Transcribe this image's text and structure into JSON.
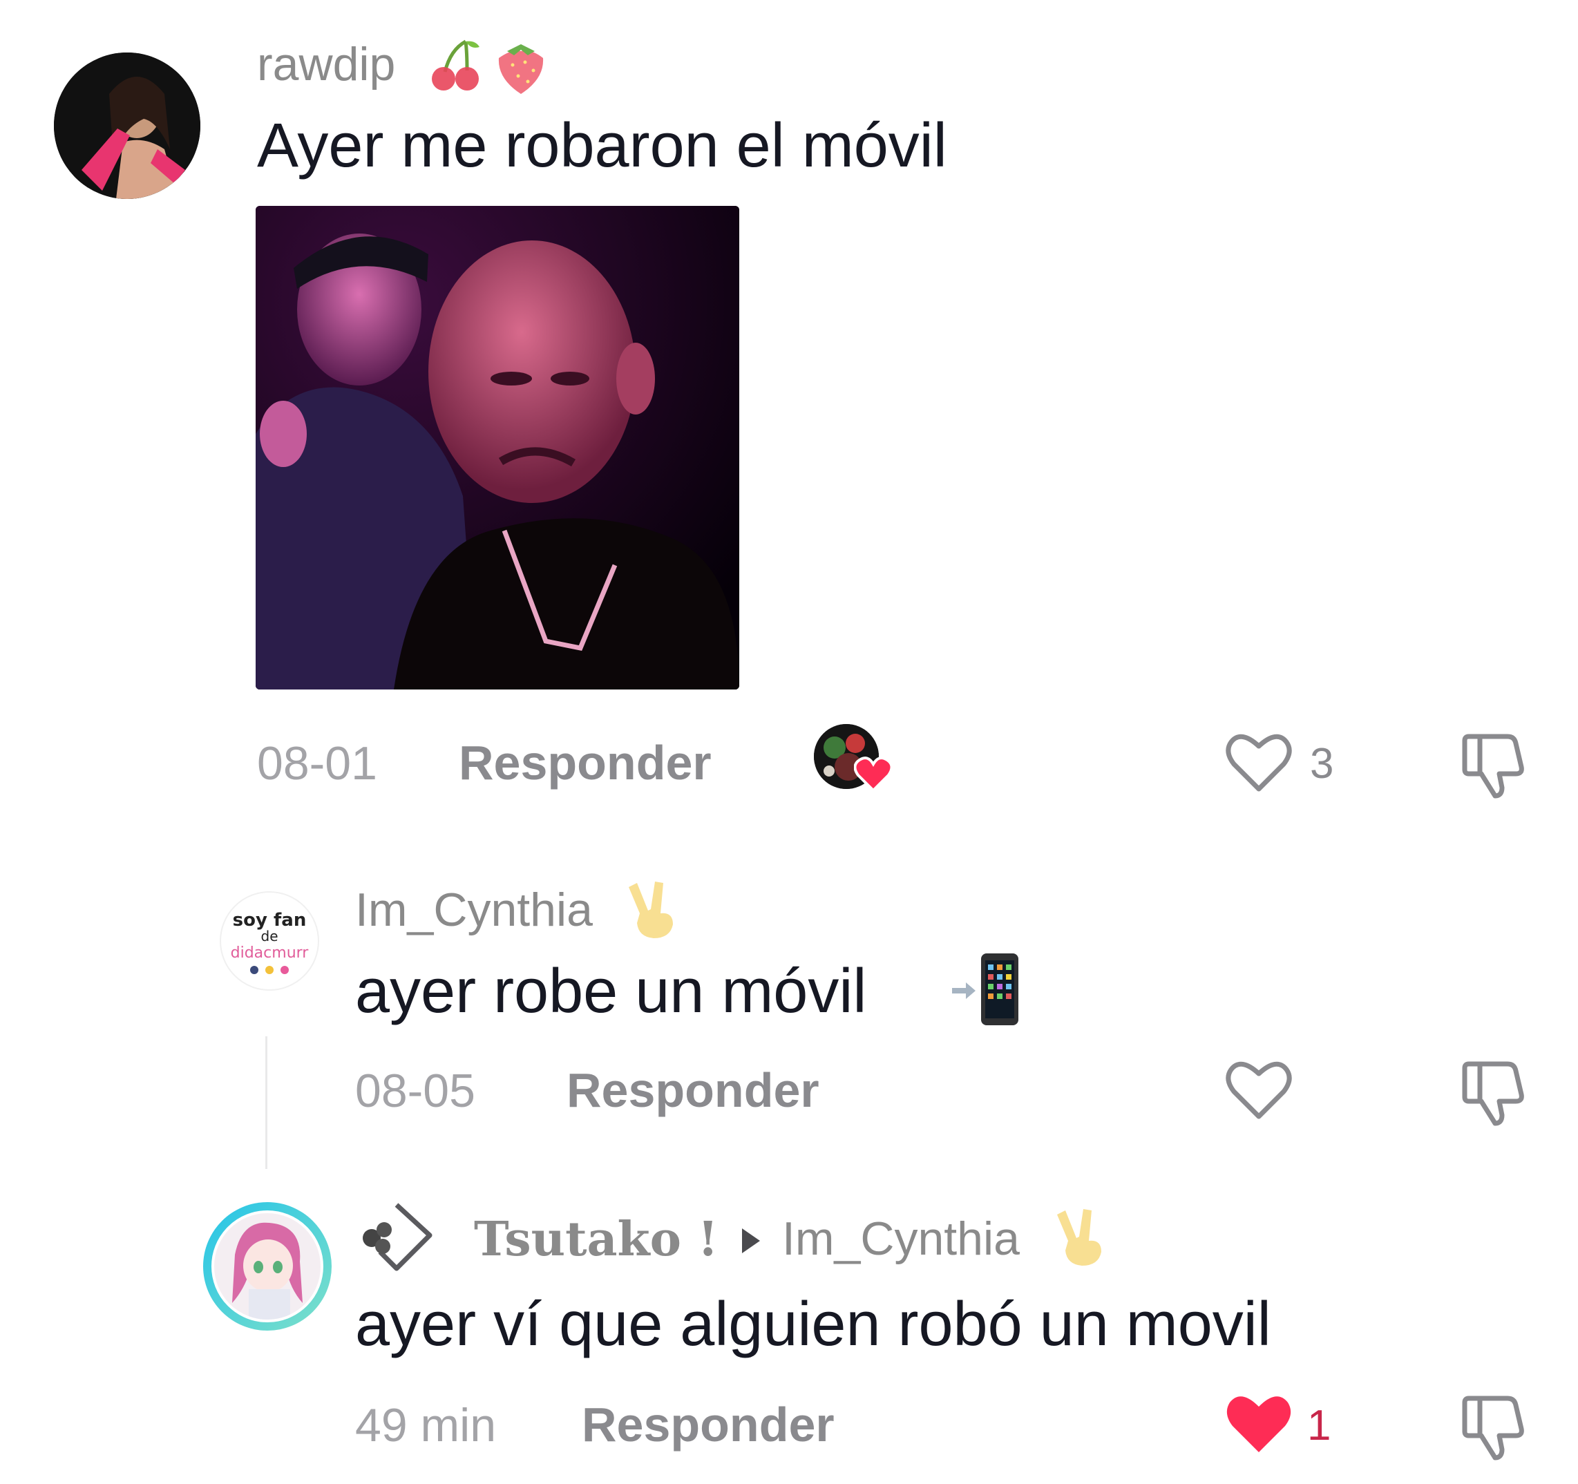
{
  "comments": [
    {
      "username": "rawdip",
      "username_emoji": [
        "cherries-emoji",
        "strawberry-emoji"
      ],
      "text": "Ayer me robaron el móvil",
      "date": "08-01",
      "reply_label": "Responder",
      "likes": "3",
      "creator_liked": true
    },
    {
      "username": "Im_Cynthia",
      "avatar_text": [
        "soy fan",
        "de",
        "didacmurr"
      ],
      "text": "ayer robe un móvil",
      "date": "08-05",
      "reply_label": "Responder"
    },
    {
      "username": "Tsutako !",
      "reply_to": "Im_Cynthia",
      "text": "ayer ví que alguien robó un movil",
      "date": "49 min",
      "reply_label": "Responder",
      "likes": "1",
      "liked": true
    }
  ],
  "colors": {
    "like_active": "#fe2c55",
    "ring_gradient": [
      "#25c4e8",
      "#7ee0c9"
    ],
    "text": "#161823",
    "secondary": "#8a8a8e"
  }
}
